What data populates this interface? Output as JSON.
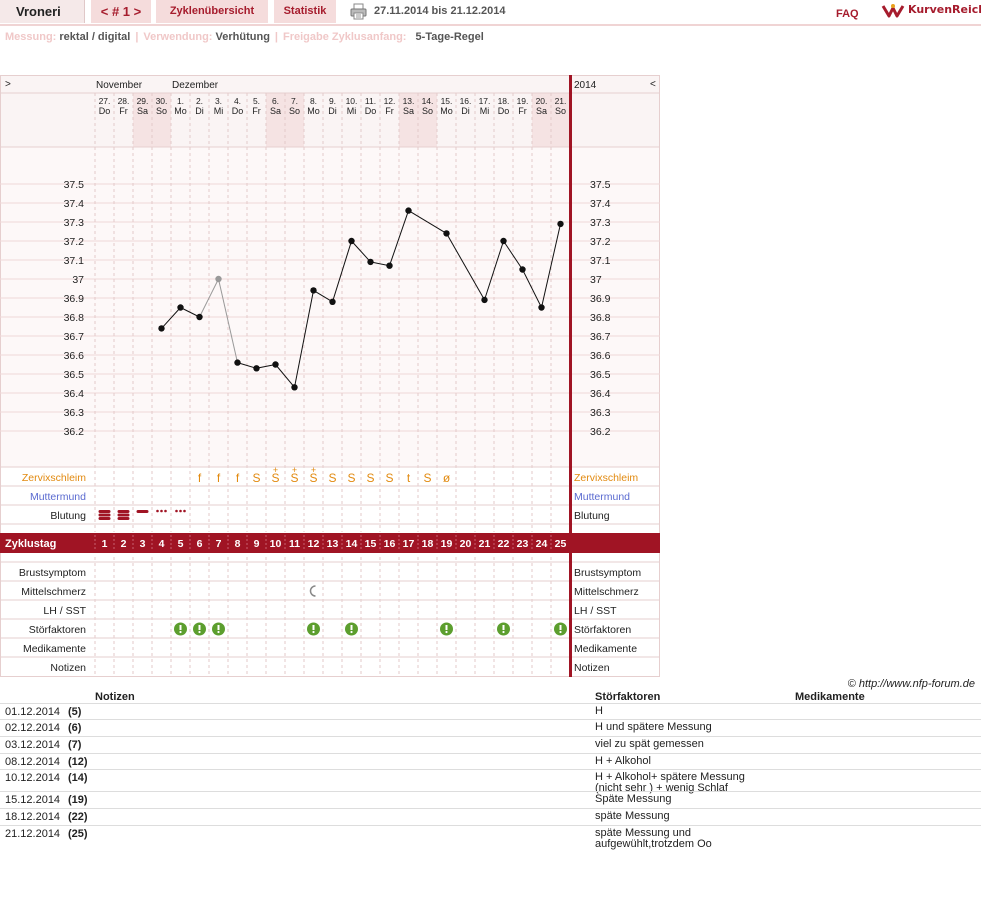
{
  "header": {
    "username": "Vroneri",
    "cycle_nav": "< # 1 >",
    "tab_overview": "Zyklenübersicht",
    "tab_stats": "Statistik",
    "daterange": "27.11.2014 bis 21.12.2014",
    "faq": "FAQ",
    "logo_text": "KurvenReich"
  },
  "settings": {
    "measure_label": "Messung:",
    "measure_value": "rektal / digital",
    "use_label": "Verwendung:",
    "use_value": "Verhütung",
    "release_label": "Freigabe Zyklusanfang:",
    "release_value": "5-Tage-Regel"
  },
  "chart_data": {
    "type": "line",
    "nav_left": ">",
    "nav_right": "<",
    "year": "2014",
    "months": [
      {
        "label": "November",
        "start_index": 0
      },
      {
        "label": "Dezember",
        "start_index": 4
      }
    ],
    "days": [
      {
        "date": "27.",
        "dow": "Do",
        "weekend": false
      },
      {
        "date": "28.",
        "dow": "Fr",
        "weekend": false
      },
      {
        "date": "29.",
        "dow": "Sa",
        "weekend": true
      },
      {
        "date": "30.",
        "dow": "So",
        "weekend": true
      },
      {
        "date": "1.",
        "dow": "Mo",
        "weekend": false
      },
      {
        "date": "2.",
        "dow": "Di",
        "weekend": false
      },
      {
        "date": "3.",
        "dow": "Mi",
        "weekend": false
      },
      {
        "date": "4.",
        "dow": "Do",
        "weekend": false
      },
      {
        "date": "5.",
        "dow": "Fr",
        "weekend": false
      },
      {
        "date": "6.",
        "dow": "Sa",
        "weekend": true
      },
      {
        "date": "7.",
        "dow": "So",
        "weekend": true
      },
      {
        "date": "8.",
        "dow": "Mo",
        "weekend": false
      },
      {
        "date": "9.",
        "dow": "Di",
        "weekend": false
      },
      {
        "date": "10.",
        "dow": "Mi",
        "weekend": false
      },
      {
        "date": "11.",
        "dow": "Do",
        "weekend": false
      },
      {
        "date": "12.",
        "dow": "Fr",
        "weekend": false
      },
      {
        "date": "13.",
        "dow": "Sa",
        "weekend": true
      },
      {
        "date": "14.",
        "dow": "So",
        "weekend": true
      },
      {
        "date": "15.",
        "dow": "Mo",
        "weekend": false
      },
      {
        "date": "16.",
        "dow": "Di",
        "weekend": false
      },
      {
        "date": "17.",
        "dow": "Mi",
        "weekend": false
      },
      {
        "date": "18.",
        "dow": "Do",
        "weekend": false
      },
      {
        "date": "19.",
        "dow": "Fr",
        "weekend": false
      },
      {
        "date": "20.",
        "dow": "Sa",
        "weekend": true
      },
      {
        "date": "21.",
        "dow": "So",
        "weekend": true
      }
    ],
    "y_ticks": [
      "37.5",
      "37.4",
      "37.3",
      "37.2",
      "37.1",
      "37",
      "36.9",
      "36.8",
      "36.7",
      "36.6",
      "36.5",
      "36.4",
      "36.3",
      "36.2"
    ],
    "ylim": [
      36.2,
      37.5
    ],
    "temperatures": [
      null,
      null,
      null,
      36.74,
      36.85,
      36.8,
      37.0,
      36.56,
      36.53,
      36.55,
      36.43,
      36.94,
      36.88,
      37.2,
      37.09,
      37.07,
      37.36,
      null,
      37.24,
      null,
      36.89,
      37.2,
      37.05,
      36.85,
      37.29
    ],
    "excluded_index": 6,
    "zyklustag": [
      "1",
      "2",
      "3",
      "4",
      "5",
      "6",
      "7",
      "8",
      "9",
      "10",
      "11",
      "12",
      "13",
      "14",
      "15",
      "16",
      "17",
      "18",
      "19",
      "20",
      "21",
      "22",
      "23",
      "24",
      "25"
    ],
    "zervix": [
      "",
      "",
      "",
      "",
      "",
      "f",
      "f",
      "f",
      "S",
      "S+",
      "S+",
      "S+",
      "S",
      "S",
      "S",
      "S",
      "t",
      "S",
      "ø",
      "",
      "",
      "",
      "",
      "",
      ""
    ],
    "bleeding": [
      "heavy",
      "heavy",
      "medium",
      "light",
      "light",
      "",
      "",
      "",
      "",
      "",
      "",
      "",
      "",
      "",
      "",
      "",
      "",
      "",
      "",
      "",
      "",
      "",
      "",
      "",
      ""
    ],
    "mittelschmerz_index": 11,
    "stoer_indices": [
      4,
      5,
      6,
      11,
      13,
      18,
      21,
      24
    ],
    "row_labels": {
      "zervix": "Zervixschleim",
      "muttermund": "Muttermund",
      "blutung": "Blutung",
      "zyklustag": "Zyklustag",
      "brust": "Brustsymptom",
      "mittel": "Mittelschmerz",
      "lh": "LH / SST",
      "stoer": "Störfaktoren",
      "medi": "Medikamente",
      "notizen": "Notizen"
    },
    "colors": {
      "accent": "#a01424",
      "grid": "#f0d8d8",
      "zervix": "#e28a10",
      "muttermund": "#5a6ad0",
      "stoer": "#5c9e2e",
      "weekend": "#f5e3e3"
    }
  },
  "copyright": "© http://www.nfp-forum.de",
  "notes": {
    "headers": {
      "notizen": "Notizen",
      "stoer": "Störfaktoren",
      "medi": "Medikamente"
    },
    "rows": [
      {
        "date": "01.12.2014",
        "day": "(5)",
        "note": "",
        "stoer": "H",
        "medi": ""
      },
      {
        "date": "02.12.2014",
        "day": "(6)",
        "note": "",
        "stoer": "H und spätere Messung",
        "medi": ""
      },
      {
        "date": "03.12.2014",
        "day": "(7)",
        "note": "",
        "stoer": "viel zu spät gemessen",
        "medi": ""
      },
      {
        "date": "08.12.2014",
        "day": "(12)",
        "note": "",
        "stoer": "H + Alkohol",
        "medi": ""
      },
      {
        "date": "10.12.2014",
        "day": "(14)",
        "note": "",
        "stoer": "H + Alkohol+ spätere Messung (nicht sehr ) + wenig Schlaf",
        "medi": ""
      },
      {
        "date": "15.12.2014",
        "day": "(19)",
        "note": "",
        "stoer": "Späte Messung",
        "medi": ""
      },
      {
        "date": "18.12.2014",
        "day": "(22)",
        "note": "",
        "stoer": "späte Messung",
        "medi": ""
      },
      {
        "date": "21.12.2014",
        "day": "(25)",
        "note": "",
        "stoer": "späte Messung und aufgewühlt,trotzdem Oo",
        "medi": ""
      }
    ]
  }
}
